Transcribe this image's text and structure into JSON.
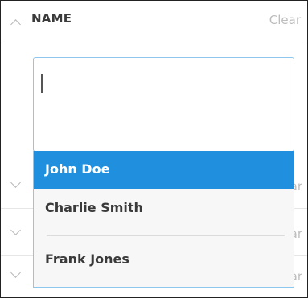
{
  "filter_header": {
    "title": "NAME",
    "clear_label": "Clear"
  },
  "search": {
    "value": "",
    "placeholder": ""
  },
  "dropdown": {
    "options": [
      {
        "label": "John Doe",
        "selected": true
      },
      {
        "label": "Charlie Smith",
        "selected": false
      },
      {
        "label": "Frank Jones",
        "selected": false
      }
    ]
  },
  "background_rows": [
    {
      "clear_partial": "ar"
    },
    {
      "clear_partial": "ar"
    },
    {
      "clear_partial": "ar"
    }
  ],
  "colors": {
    "selected_bg": "#1f8fde",
    "focus_border": "#8ec6ee",
    "clear_text": "#bdbdbd"
  },
  "icons": {
    "expand_up": "chevron-up-icon",
    "collapse_down": "chevron-down-icon"
  }
}
